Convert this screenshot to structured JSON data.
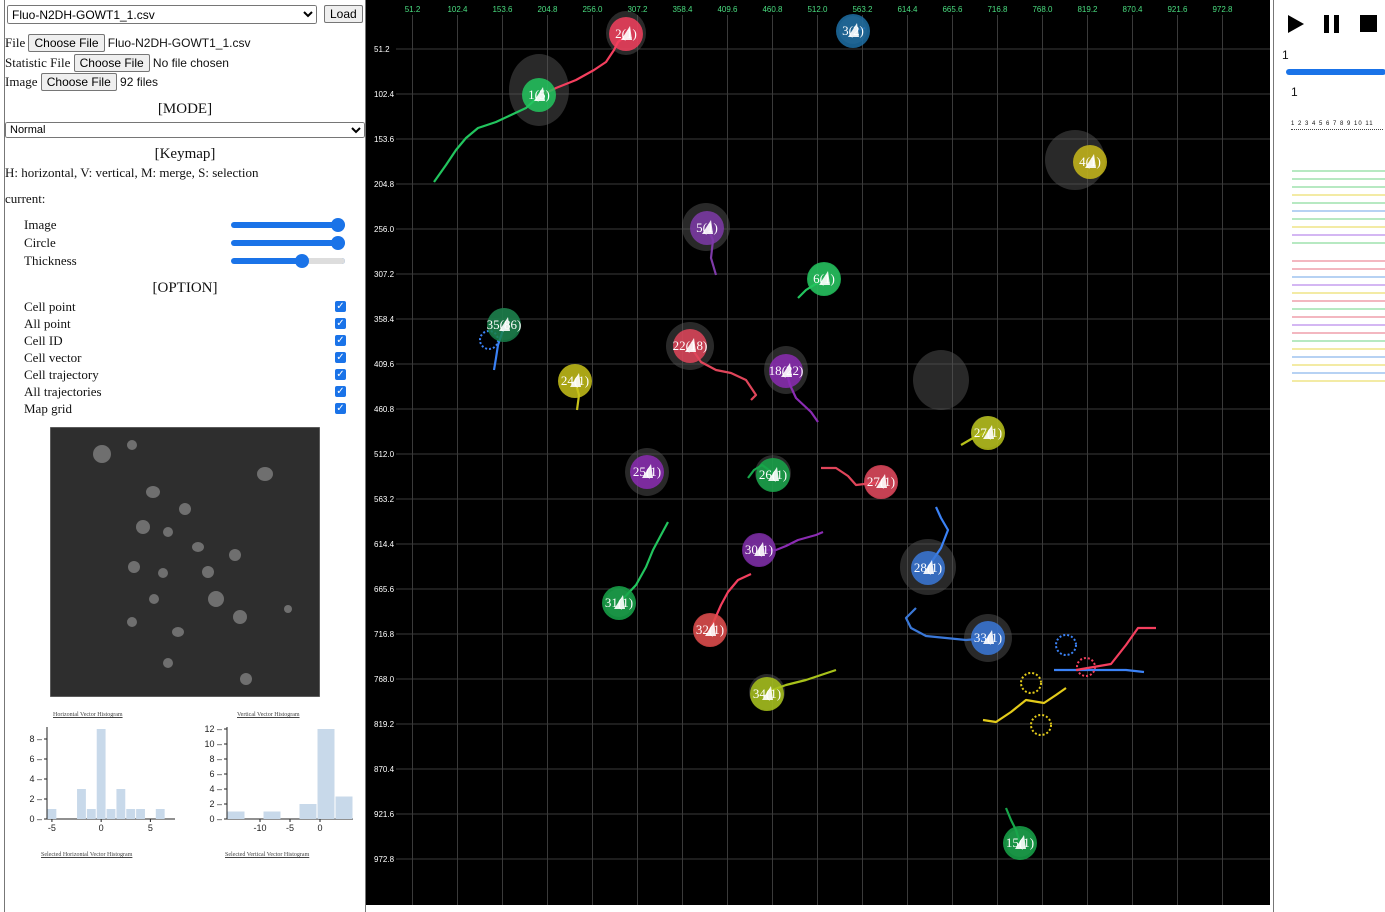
{
  "left_panel": {
    "csv_select": "Fluo-N2DH-GOWT1_1.csv",
    "load_button": "Load",
    "file_label": "File",
    "file_button": "Choose File",
    "file_value": "Fluo-N2DH-GOWT1_1.csv",
    "stat_label": "Statistic File",
    "stat_button": "Choose File",
    "stat_value": "No file chosen",
    "image_label": "Image",
    "image_button": "Choose File",
    "image_value": "92 files",
    "mode_heading": "[MODE]",
    "mode_select": "Normal",
    "keymap_heading": "[Keymap]",
    "keymap_text": "H: horizontal, V: vertical, M: merge, S: selection",
    "current_label": "current:",
    "sliders": [
      {
        "label": "Image",
        "value": 1.0
      },
      {
        "label": "Circle",
        "value": 1.0
      },
      {
        "label": "Thickness",
        "value": 0.62
      }
    ],
    "option_heading": "[OPTION]",
    "options": [
      {
        "label": "Cell point",
        "checked": true
      },
      {
        "label": "All point",
        "checked": true
      },
      {
        "label": "Cell ID",
        "checked": true
      },
      {
        "label": "Cell vector",
        "checked": true
      },
      {
        "label": "Cell trajectory",
        "checked": true
      },
      {
        "label": "All trajectories",
        "checked": true
      },
      {
        "label": "Map grid",
        "checked": true
      }
    ]
  },
  "histograms": {
    "h_title": "Horizontal Vector Histogram",
    "v_title": "Vertical Vector Histogram",
    "h_selected": "Selected Horizontal Vector Histogram",
    "v_selected": "Selected Vertical Vector Histogram"
  },
  "chart_data": [
    {
      "type": "bar",
      "title": "Horizontal Vector Histogram",
      "x": [
        -5,
        -4,
        -3,
        -2,
        -1,
        0,
        1,
        2,
        3,
        4,
        5,
        6,
        7
      ],
      "values": [
        1,
        0,
        0,
        3,
        1,
        9,
        1,
        3,
        1,
        1,
        0,
        1,
        0
      ],
      "xticks": [
        -5,
        0,
        5
      ],
      "yticks": [
        0,
        2,
        4,
        6,
        8
      ],
      "ylim": [
        0,
        9
      ]
    },
    {
      "type": "bar",
      "title": "Vertical Vector Histogram",
      "x": [
        -14,
        -11,
        -8,
        -5,
        -2,
        1,
        4
      ],
      "values": [
        1,
        0,
        1,
        0,
        2,
        12,
        3
      ],
      "xticks": [
        -10,
        -5,
        0
      ],
      "yticks": [
        0,
        2,
        4,
        6,
        8,
        10,
        12
      ],
      "ylim": [
        0,
        12
      ]
    }
  ],
  "map": {
    "x_ticks": [
      "51.2",
      "102.4",
      "153.6",
      "204.8",
      "256.0",
      "307.2",
      "358.4",
      "409.6",
      "460.8",
      "512.0",
      "563.2",
      "614.4",
      "665.6",
      "716.8",
      "768.0",
      "819.2",
      "870.4",
      "921.6",
      "972.8"
    ],
    "y_ticks": [
      "51.2",
      "102.4",
      "153.6",
      "204.8",
      "256.0",
      "307.2",
      "358.4",
      "409.6",
      "460.8",
      "512.0",
      "563.2",
      "614.4",
      "665.6",
      "716.8",
      "768.0",
      "819.2",
      "870.4",
      "921.6",
      "972.8"
    ],
    "cells": [
      {
        "label": "1(5)",
        "color": "#22c55e"
      },
      {
        "label": "2(1)",
        "color": "#f43f5e"
      },
      {
        "label": "3(2)",
        "color": "#1d6fa5"
      },
      {
        "label": "4(1)",
        "color": "#c8b81a"
      },
      {
        "label": "5(1)",
        "color": "#7e3aa8"
      },
      {
        "label": "6(1)",
        "color": "#22c55e"
      },
      {
        "label": "35(86)",
        "color": "#17804a"
      },
      {
        "label": "22(18)",
        "color": "#e0455a"
      },
      {
        "label": "24(1)",
        "color": "#c8c21a"
      },
      {
        "label": "18(22)",
        "color": "#8b2cb3"
      },
      {
        "label": "27(1)",
        "color": "#b8c21a"
      },
      {
        "label": "25(1)",
        "color": "#8b2cb3"
      },
      {
        "label": "26(1)",
        "color": "#17a64a"
      },
      {
        "label": "27(1)",
        "color": "#e0455a"
      },
      {
        "label": "30(1)",
        "color": "#7e2aa8"
      },
      {
        "label": "28(1)",
        "color": "#3a78d8"
      },
      {
        "label": "31(1)",
        "color": "#17a64a"
      },
      {
        "label": "32(1)",
        "color": "#e04a4a"
      },
      {
        "label": "33(1)",
        "color": "#3a78d8"
      },
      {
        "label": "34(1)",
        "color": "#a8c21a"
      },
      {
        "label": "15(1)",
        "color": "#17a64a"
      }
    ]
  },
  "playback": {
    "play_icon": "play-icon",
    "pause_icon": "pause-icon",
    "stop_icon": "stop-icon",
    "frame_top": "1",
    "frame_bottom": "1",
    "progress": 1.0,
    "ruler": "1 2 3 4 5 6 7 8 9 10 11"
  }
}
